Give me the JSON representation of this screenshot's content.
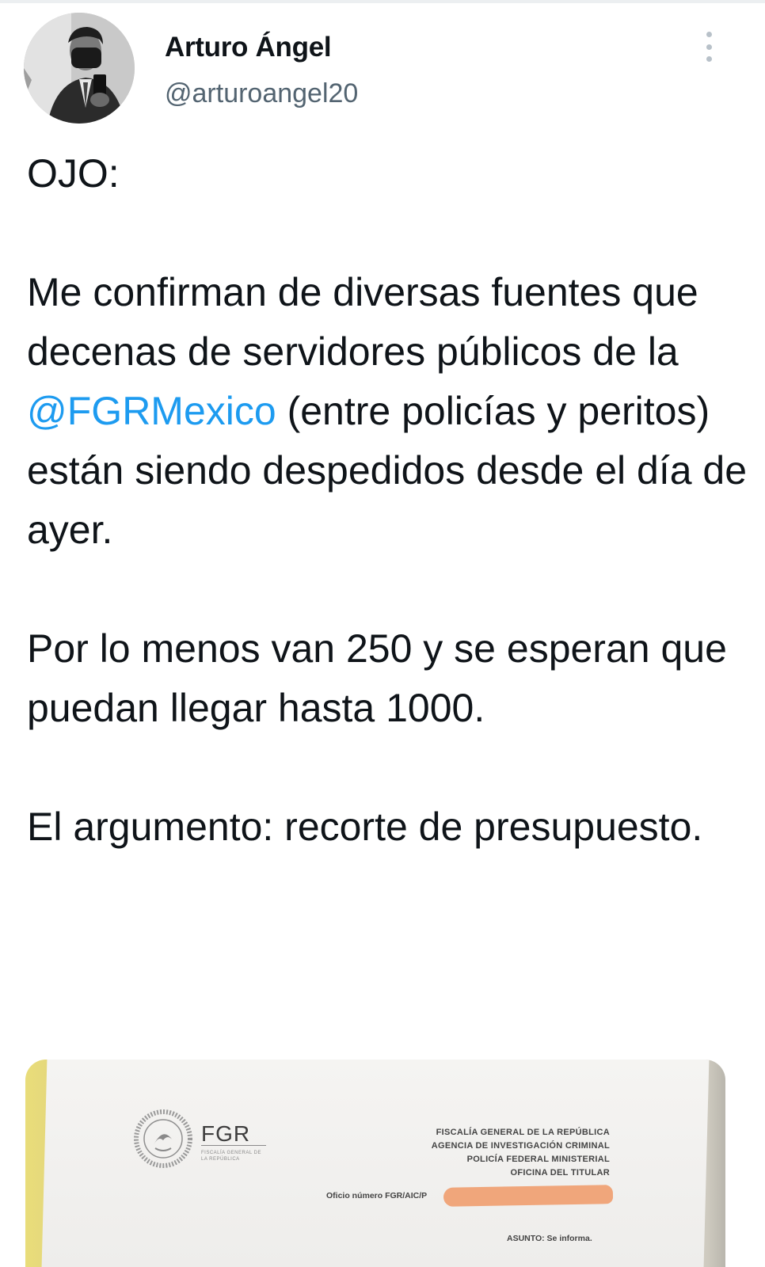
{
  "author": {
    "display_name": "Arturo Ángel",
    "handle": "@arturoangel20"
  },
  "tweet": {
    "heading": "OJO:",
    "para1_before_mention": "Me confirman de diversas fuentes que decenas de servidores públicos de la ",
    "mention": "@FGRMexico",
    "para1_after_mention": " (entre policías y peritos) están siendo despedidos desde el día de ayer.",
    "para2": "Por lo menos van 250 y se esperan que puedan llegar hasta 1000.",
    "para3": "El argumento: recorte de presupuesto."
  },
  "media": {
    "logo_text": "FGR",
    "logo_subtitle": "FISCALÍA GENERAL DE LA REPÚBLICA",
    "office_lines": [
      "FISCALÍA GENERAL DE LA REPÚBLICA",
      "AGENCIA DE INVESTIGACIÓN CRIMINAL",
      "POLICÍA FEDERAL MINISTERIAL",
      "OFICINA DEL TITULAR"
    ],
    "oficio_label": "Oficio número FGR/AIC/P",
    "asunto_label": "ASUNTO: Se informa."
  },
  "colors": {
    "text": "#0f1419",
    "secondary": "#536471",
    "link": "#1d9bf0",
    "redaction": "#f0a071"
  },
  "icons": {
    "more": "more-vertical-icon",
    "seal": "mexico-seal-icon"
  }
}
